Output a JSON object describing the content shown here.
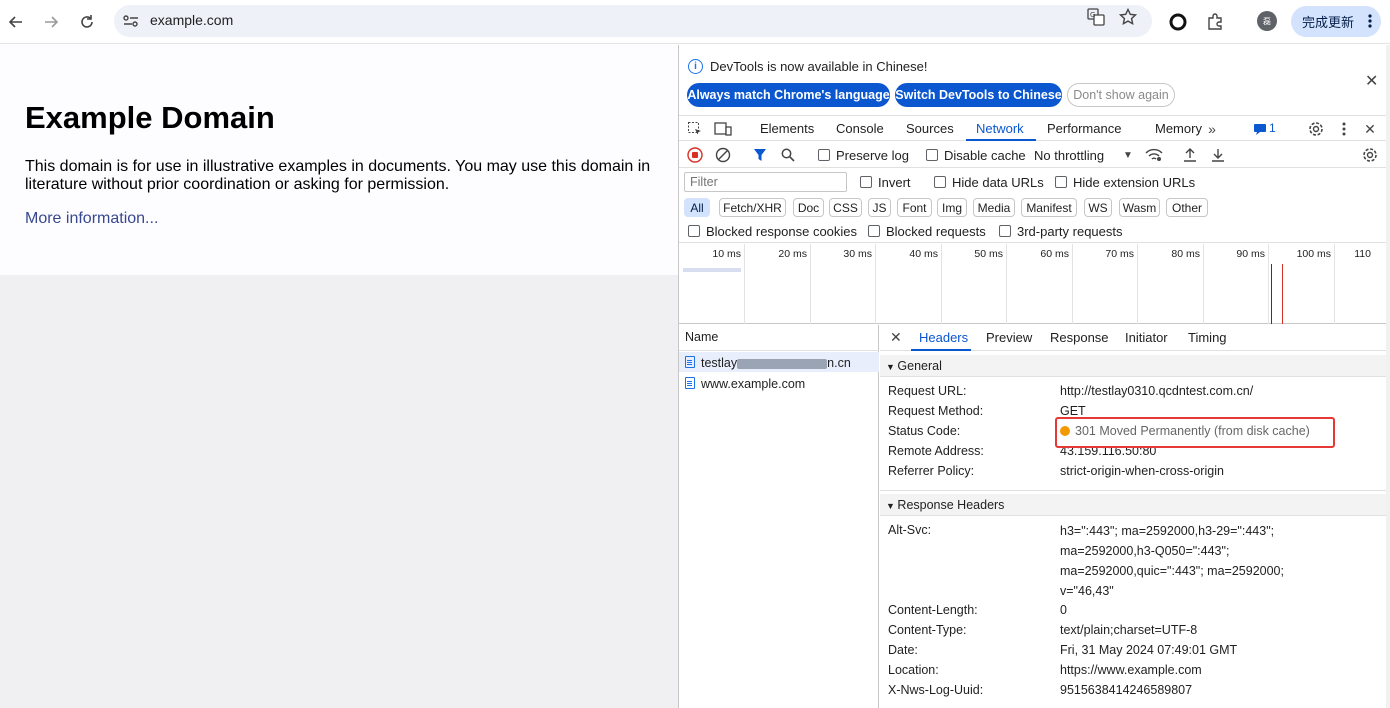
{
  "browser": {
    "url": "example.com",
    "update_label": "完成更新",
    "avatar_initial": "磊"
  },
  "page": {
    "heading": "Example Domain",
    "body": "This domain is for use in illustrative examples in documents. You may use this domain in literature without prior coordination or asking for permission.",
    "link": "More information..."
  },
  "devtools": {
    "info": {
      "message": "DevTools is now available in Chinese!",
      "btn_match": "Always match Chrome's language",
      "btn_switch": "Switch DevTools to Chinese",
      "btn_dont_show": "Don't show again"
    },
    "tabs": [
      "Elements",
      "Console",
      "Sources",
      "Network",
      "Performance",
      "Memory"
    ],
    "active_tab": "Network",
    "issues_count": "1",
    "toolbar": {
      "preserve_log": "Preserve log",
      "disable_cache": "Disable cache",
      "throttling": "No throttling"
    },
    "filter": {
      "placeholder": "Filter",
      "invert": "Invert",
      "hide_data_urls": "Hide data URLs",
      "hide_extension_urls": "Hide extension URLs"
    },
    "types": [
      "All",
      "Fetch/XHR",
      "Doc",
      "CSS",
      "JS",
      "Font",
      "Img",
      "Media",
      "Manifest",
      "WS",
      "Wasm",
      "Other"
    ],
    "blocked": {
      "cookies": "Blocked response cookies",
      "requests": "Blocked requests",
      "third_party": "3rd-party requests"
    },
    "timeline_ticks": [
      "10 ms",
      "20 ms",
      "30 ms",
      "40 ms",
      "50 ms",
      "60 ms",
      "70 ms",
      "80 ms",
      "90 ms",
      "100 ms",
      "110"
    ],
    "requests": {
      "header": "Name",
      "rows": [
        {
          "prefix": "testlay",
          "suffix": "n.cn"
        },
        {
          "prefix": "www.example.com",
          "suffix": ""
        }
      ]
    },
    "details": {
      "tabs": [
        "Headers",
        "Preview",
        "Response",
        "Initiator",
        "Timing"
      ],
      "general_title": "General",
      "general": {
        "request_url_key": "Request URL:",
        "request_url_val": "http://testlay0310.qcdntest.com.cn/",
        "method_key": "Request Method:",
        "method_val": "GET",
        "status_key": "Status Code:",
        "status_val": "301 Moved Permanently (from disk cache)",
        "remote_key": "Remote Address:",
        "remote_val": "43.159.116.50:80",
        "referrer_key": "Referrer Policy:",
        "referrer_val": "strict-origin-when-cross-origin"
      },
      "response_title": "Response Headers",
      "response": {
        "alt_svc_key": "Alt-Svc:",
        "alt_svc_val": "h3=\":443\"; ma=2592000,h3-29=\":443\"; ma=2592000,h3-Q050=\":443\"; ma=2592000,quic=\":443\"; ma=2592000; v=\"46,43\"",
        "content_length_key": "Content-Length:",
        "content_length_val": "0",
        "content_type_key": "Content-Type:",
        "content_type_val": "text/plain;charset=UTF-8",
        "date_key": "Date:",
        "date_val": "Fri, 31 May 2024 07:49:01 GMT",
        "location_key": "Location:",
        "location_val": "https://www.example.com",
        "uuid_key": "X-Nws-Log-Uuid:",
        "uuid_val": "9515638414246589807"
      }
    }
  }
}
